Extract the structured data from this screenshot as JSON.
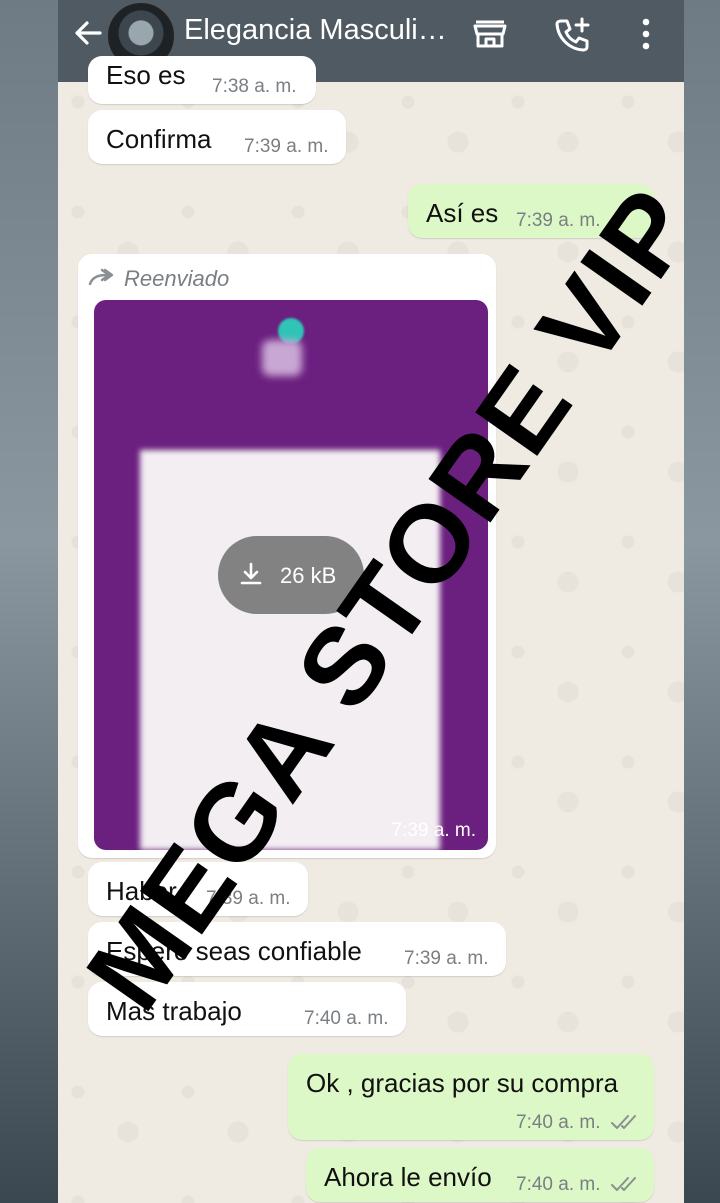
{
  "header": {
    "title": "Elegancia Masculi…",
    "icons": [
      "back-arrow-icon",
      "store-icon",
      "add-call-icon",
      "more-options-icon"
    ]
  },
  "messages": [
    {
      "direction": "in",
      "text": "Eso es",
      "time": "7:38 a. m."
    },
    {
      "direction": "in",
      "text": "Confirma",
      "time": "7:39 a. m."
    },
    {
      "direction": "out",
      "text": "Así es",
      "time": "7:39 a. m."
    },
    {
      "direction": "in",
      "type": "image",
      "forwarded_label": "Reenviado",
      "download_size": "26 kB",
      "time": "7:39 a. m."
    },
    {
      "direction": "in",
      "text": "Haber",
      "time": "7:39 a. m."
    },
    {
      "direction": "in",
      "text": "Espero seas confiable",
      "time": "7:39 a. m."
    },
    {
      "direction": "in",
      "text": "Mas trabajo",
      "time": "7:40 a. m."
    },
    {
      "direction": "out",
      "text": "Ok , gracias por su compra",
      "time": "7:40 a. m."
    },
    {
      "direction": "out",
      "text": "Ahora le envío",
      "time": "7:40 a. m."
    }
  ],
  "watermark": "MEGA STORE VIP",
  "colors": {
    "header": "#4f5a62",
    "incoming_bubble": "#ffffff",
    "outgoing_bubble": "#dcf8c6",
    "chat_background": "#efeae2",
    "image_background": "#6b1f7f"
  }
}
